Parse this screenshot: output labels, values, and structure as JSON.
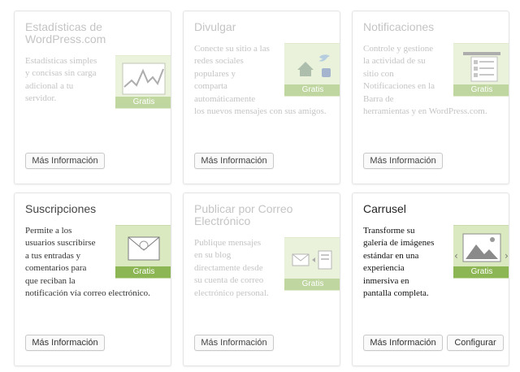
{
  "modules": [
    {
      "title": "Estadísticas de WordPress.com",
      "description": [
        "Estadísticas simples",
        "y concisas sin carga",
        "adicional a tu",
        "servidor."
      ],
      "badge": "Gratis",
      "more_label": "Más Información",
      "icon": "stats-chart-icon"
    },
    {
      "title": "Divulgar",
      "description": [
        "Conecte su sitio a las",
        "redes sociales",
        "populares y",
        "comparta",
        "automáticamente",
        "los nuevos mensajes con sus amigos."
      ],
      "badge": "Gratis",
      "more_label": "Más Información",
      "icon": "social-share-icon"
    },
    {
      "title": "Notificaciones",
      "description": [
        "Controle y gestione",
        "la actividad de su",
        "sitio con",
        "Notificaciones en la",
        "Barra de",
        "herramientas y en WordPress.com."
      ],
      "badge": "Gratis",
      "more_label": "Más Información",
      "icon": "notifications-list-icon"
    },
    {
      "title": "Suscripciones",
      "description": [
        "Permite a los",
        "usuarios suscribirse",
        "a tus entradas y",
        "comentarios para",
        "que reciban la",
        "notificación vía correo electrónico."
      ],
      "badge": "Gratis",
      "more_label": "Más Información",
      "icon": "email-envelope-icon"
    },
    {
      "title": "Publicar por Correo Electrónico",
      "description": [
        "Publique mensajes",
        "en su blog",
        "directamente desde",
        "su cuenta de correo",
        "electrónico personal."
      ],
      "badge": "Gratis",
      "more_label": "Más Información",
      "icon": "email-to-post-icon"
    },
    {
      "title": "Carrusel",
      "description": [
        "Transforme su",
        "galería de imágenes",
        "estándar en una",
        "experiencia",
        "inmersiva en",
        "pantalla completa."
      ],
      "badge": "Gratis",
      "more_label": "Más Información",
      "config_label": "Configurar",
      "icon": "image-carousel-icon"
    }
  ],
  "colors": {
    "badge": "#8cb653",
    "illustration_bg": "#dbe9c0",
    "dim_text": "#c4c4c4"
  }
}
